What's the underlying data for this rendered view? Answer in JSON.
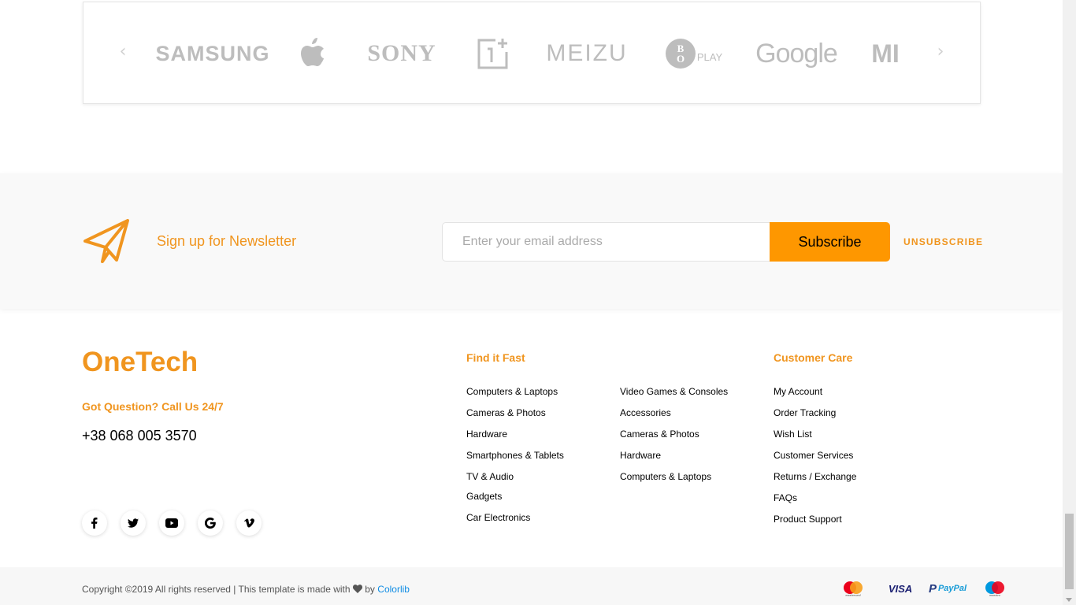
{
  "brands": {
    "prev_arrow": "‹",
    "next_arrow": "›",
    "items": {
      "samsung": "SAMSUNG",
      "apple": "apple-logo-icon",
      "sony": "SONY",
      "oneplus": "oneplus-logo-icon",
      "meizu": "MEIZU",
      "bo_play": "PLAY",
      "google": "Google",
      "mi": "MI"
    }
  },
  "newsletter": {
    "title": "Sign up for Newsletter",
    "email_placeholder": "Enter your email address",
    "subscribe_label": "Subscribe",
    "unsubscribe_label": "UNSUBSCRIBE"
  },
  "footer": {
    "logo": "OneTech",
    "question": "Got Question? Call Us 24/7",
    "phone": "+38 068 005 3570",
    "socials": [
      "f",
      "t",
      "yt",
      "G",
      "v"
    ],
    "find_it_fast": {
      "title": "Find it Fast",
      "col1": [
        "Computers & Laptops",
        "Cameras & Photos",
        "Hardware",
        "Smartphones & Tablets",
        "TV & Audio",
        "Gadgets",
        "Car Electronics"
      ],
      "col2": [
        "Video Games & Consoles",
        "Accessories",
        "Cameras & Photos",
        "Hardware",
        "Computers & Laptops"
      ]
    },
    "customer_care": {
      "title": "Customer Care",
      "items": [
        "My Account",
        "Order Tracking",
        "Wish List",
        "Customer Services",
        "Returns / Exchange",
        "FAQs",
        "Product Support"
      ]
    }
  },
  "bottom": {
    "copyright_prefix": "Copyright ©2019 All rights reserved | This template is made with",
    "by": "by",
    "link": "Colorlib",
    "payments": [
      "mastercard",
      "VISA",
      "PayPal",
      "maestro"
    ]
  },
  "colors": {
    "accent": "#f0951f",
    "button": "#fe9700",
    "link": "#0e8ce4"
  }
}
